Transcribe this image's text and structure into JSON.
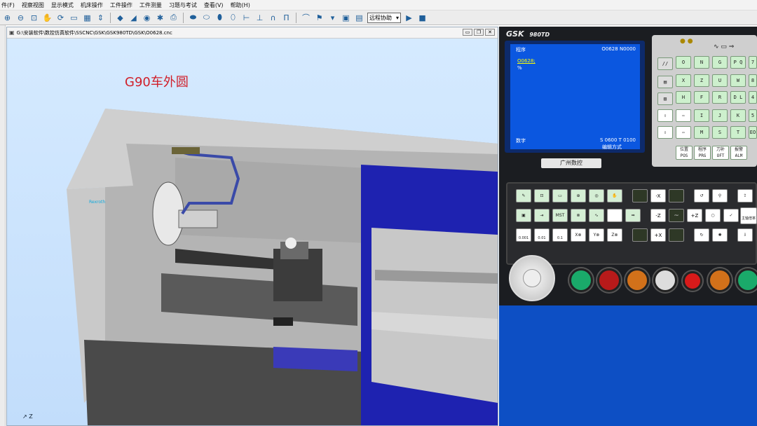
{
  "menu": [
    "件(F)",
    "视察视图",
    "显示模式",
    "机床操作",
    "工件操作",
    "工件测量",
    "习题与考试",
    "查看(V)",
    "帮助(H)"
  ],
  "toolbar": {
    "mode_select": "远程协助",
    "mode_arrow": "▾"
  },
  "sim_window": {
    "title": "G:\\安装软件\\数控仿真软件\\SSCNC\\GSK\\GSK980TD\\GSK\\O0628.cnc",
    "min": "▭",
    "restore": "❐",
    "close": "✕"
  },
  "viewport": {
    "annotation": "G90车外圆",
    "axis_z": "Z",
    "brand_tag": "Rexroth"
  },
  "gsk": {
    "logo": "GSK",
    "model": "980TD",
    "screen": {
      "mode": "程序",
      "header_right": "O0628 N0000",
      "program_line": "O0628;",
      "cursor": "%",
      "input_label": "数字",
      "status": "S 0600   T 0100",
      "mode_label": "编辑方式"
    },
    "brand": "广州数控",
    "keys_row1": [
      "O",
      "N",
      "G",
      "P\nQ",
      "7"
    ],
    "keys_row2": [
      "X",
      "Z",
      "U",
      "W",
      "8"
    ],
    "keys_row3": [
      "H",
      "F",
      "R",
      "D\nL",
      "4"
    ],
    "keys_row4": [
      "I",
      "J",
      "K",
      "5"
    ],
    "keys_row5": [
      "M",
      "S",
      "T",
      "EO"
    ],
    "slash": "//",
    "func_keys": [
      "位置\nPOS",
      "程序\nPRG",
      "刀补\nOFT",
      "报警\nALM"
    ],
    "jog": {
      "neg_x": "-X",
      "neg_z": "-Z",
      "pos_z": "+Z",
      "pos_x": "+X",
      "spindle": "~"
    },
    "step": {
      "s1": "0.001",
      "s2": "0.01",
      "s3": "0.1",
      "x": "X⊗",
      "y": "Y⊗",
      "z": "Z⊗"
    },
    "speed_label": "主轴倍率",
    "mst_label": "MST"
  },
  "colors": {
    "accent": "#0b57e0",
    "title_red": "#d0202a"
  }
}
